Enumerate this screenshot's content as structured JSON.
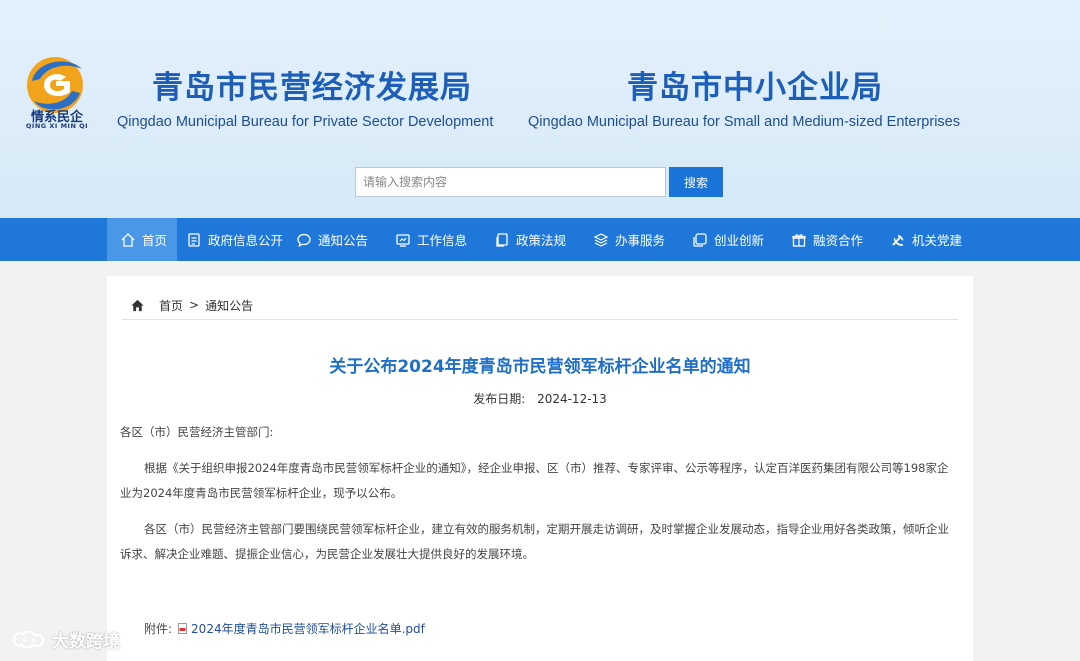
{
  "header": {
    "logo_text": "情系民企",
    "logo_sub": "QING XI MIN QI",
    "bureau1_cn": "青岛市民营经济发展局",
    "bureau1_en": "Qingdao Municipal Bureau for Private Sector Development",
    "bureau2_cn": "青岛市中小企业局",
    "bureau2_en": "Qingdao Municipal Bureau for Small and Medium-sized Enterprises"
  },
  "search": {
    "placeholder": "请输入搜索内容",
    "button_label": "搜索"
  },
  "nav": {
    "items": [
      {
        "label": "首页",
        "icon": "home-icon"
      },
      {
        "label": "政府信息公开",
        "icon": "document-icon"
      },
      {
        "label": "通知公告",
        "icon": "chat-icon"
      },
      {
        "label": "工作信息",
        "icon": "monitor-icon"
      },
      {
        "label": "政策法规",
        "icon": "copy-icon"
      },
      {
        "label": "办事服务",
        "icon": "layers-icon"
      },
      {
        "label": "创业创新",
        "icon": "square-icon"
      },
      {
        "label": "融资合作",
        "icon": "gift-icon"
      },
      {
        "label": "机关党建",
        "icon": "party-emblem-icon"
      }
    ],
    "active_index": 0
  },
  "breadcrumb": {
    "home": "首页",
    "separator": ">",
    "current": "通知公告"
  },
  "article": {
    "title": "关于公布2024年度青岛市民营领军标杆企业名单的通知",
    "date_label": "发布日期:",
    "date": "2024-12-13",
    "salutation": "各区（市）民营经济主管部门:",
    "para1_line1": "根据《关于组织申报2024年度青岛市民营领军标杆企业的通知》，经企业申报、区（市）推荐、专家评审、公示等程序，认定百洋医药集团有限公司等198家企",
    "para1_line2": "业为2024年度青岛市民营领军标杆企业，现予以公布。",
    "para2_line1": "各区（市）民营经济主管部门要围绕民营领军标杆企业，建立有效的服务机制，定期开展走访调研，及时掌握企业发展动态，指导企业用好各类政策，倾听企业",
    "para2_line2": "诉求、解决企业难题、提振企业信心，为民营企业发展壮大提供良好的发展环境。",
    "attachment_label": "附件:",
    "attachment_file": "2024年度青岛市民营领军标杆企业名单.pdf"
  },
  "watermark": {
    "text": "大数跨境"
  },
  "colors": {
    "nav_bg": "#1f78d9",
    "title_blue": "#1f6fc8",
    "search_button": "#1a73d6"
  }
}
